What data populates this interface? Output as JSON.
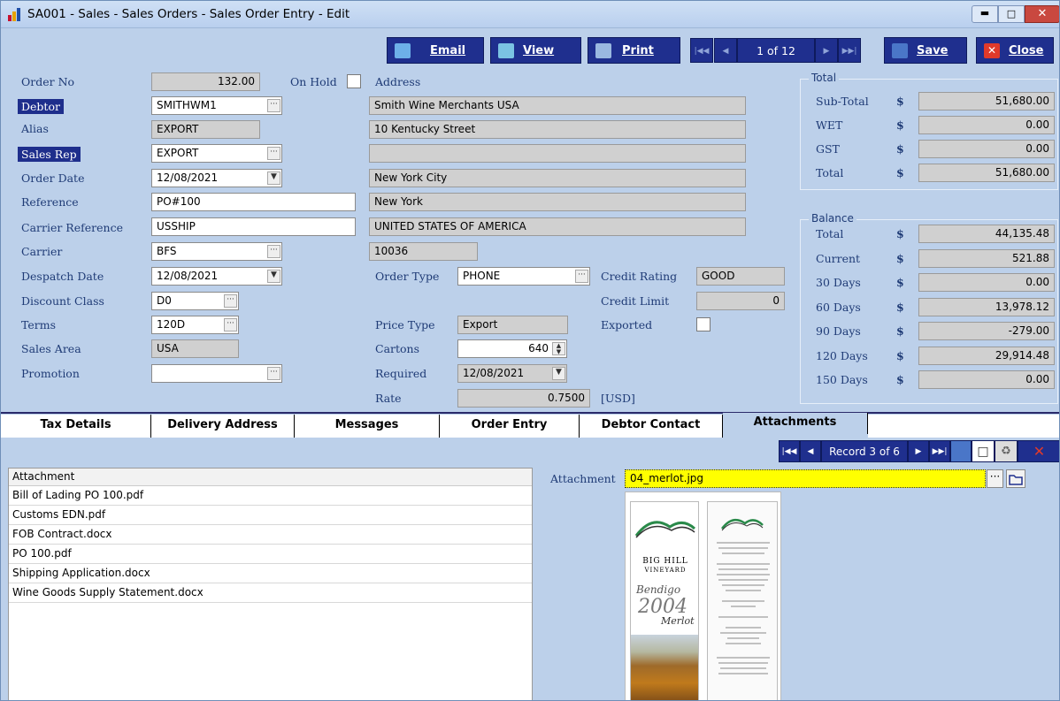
{
  "window": {
    "title": "SA001 - Sales - Sales Orders - Sales Order Entry - Edit"
  },
  "toolbar": {
    "email": "Email",
    "view": "View",
    "print": "Print",
    "record": "1 of 12",
    "save": "Save",
    "close": "Close"
  },
  "order": {
    "order_no_label": "Order No",
    "order_no": "132.00",
    "on_hold_label": "On Hold",
    "address_label": "Address",
    "debtor_label": "Debtor",
    "debtor": "SMITHWM1",
    "alias_label": "Alias",
    "alias": "EXPORT",
    "sales_rep_label": "Sales Rep",
    "sales_rep": "EXPORT",
    "order_date_label": "Order Date",
    "order_date": "12/08/2021",
    "reference_label": "Reference",
    "reference": "PO#100",
    "carrier_ref_label": "Carrier Reference",
    "carrier_ref": "USSHIP",
    "carrier_label": "Carrier",
    "carrier": "BFS",
    "despatch_label": "Despatch Date",
    "despatch": "12/08/2021",
    "discount_label": "Discount Class",
    "discount": "D0",
    "terms_label": "Terms",
    "terms": "120D",
    "sales_area_label": "Sales Area",
    "sales_area": "USA",
    "promotion_label": "Promotion",
    "promotion": ""
  },
  "address": {
    "line1": "Smith Wine Merchants USA",
    "line2": "10 Kentucky Street",
    "line3": "",
    "line4": "New York City",
    "line5": "New York",
    "line6": "UNITED STATES OF AMERICA",
    "postcode": "10036"
  },
  "middle": {
    "order_type_label": "Order Type",
    "order_type": "PHONE",
    "credit_rating_label": "Credit Rating",
    "credit_rating": "GOOD",
    "credit_limit_label": "Credit Limit",
    "credit_limit": "0",
    "price_type_label": "Price Type",
    "price_type": "Export",
    "exported_label": "Exported",
    "cartons_label": "Cartons",
    "cartons": "640",
    "required_label": "Required",
    "required": "12/08/2021",
    "rate_label": "Rate",
    "rate": "0.7500",
    "rate_currency": "[USD]"
  },
  "totals": {
    "group_label": "Total",
    "currency": "$",
    "rows": [
      {
        "label": "Sub-Total",
        "value": "51,680.00"
      },
      {
        "label": "WET",
        "value": "0.00"
      },
      {
        "label": "GST",
        "value": "0.00"
      },
      {
        "label": "Total",
        "value": "51,680.00"
      }
    ]
  },
  "balance": {
    "group_label": "Balance",
    "currency": "$",
    "rows": [
      {
        "label": "Total",
        "value": "44,135.48"
      },
      {
        "label": "Current",
        "value": "521.88"
      },
      {
        "label": "30 Days",
        "value": "0.00"
      },
      {
        "label": "60 Days",
        "value": "13,978.12"
      },
      {
        "label": "90 Days",
        "value": "-279.00"
      },
      {
        "label": "120 Days",
        "value": "29,914.48"
      },
      {
        "label": "150 Days",
        "value": "0.00"
      }
    ]
  },
  "tabs": [
    {
      "label": "Tax Details"
    },
    {
      "label": "Delivery Address"
    },
    {
      "label": "Messages"
    },
    {
      "label": "Order Entry"
    },
    {
      "label": "Debtor Contact"
    },
    {
      "label": "Attachments"
    }
  ],
  "attachments": {
    "record": "Record 3 of 6",
    "column": "Attachment",
    "items": [
      "Bill of Lading PO 100.pdf",
      "Customs EDN.pdf",
      "FOB Contract.docx",
      "PO 100.pdf",
      "Shipping Application.docx",
      "Wine Goods Supply Statement.docx"
    ],
    "field_label": "Attachment",
    "field_value": "04_merlot.jpg"
  },
  "preview": {
    "brand1": "BIG HILL",
    "brand2": "VINEYARD",
    "script1": "Bendigo",
    "year": "2004",
    "script2": "Merlot"
  },
  "colors": {
    "accent": "#1f2f8e",
    "background": "#bcd0ea",
    "highlight_field": "#ffff00"
  }
}
